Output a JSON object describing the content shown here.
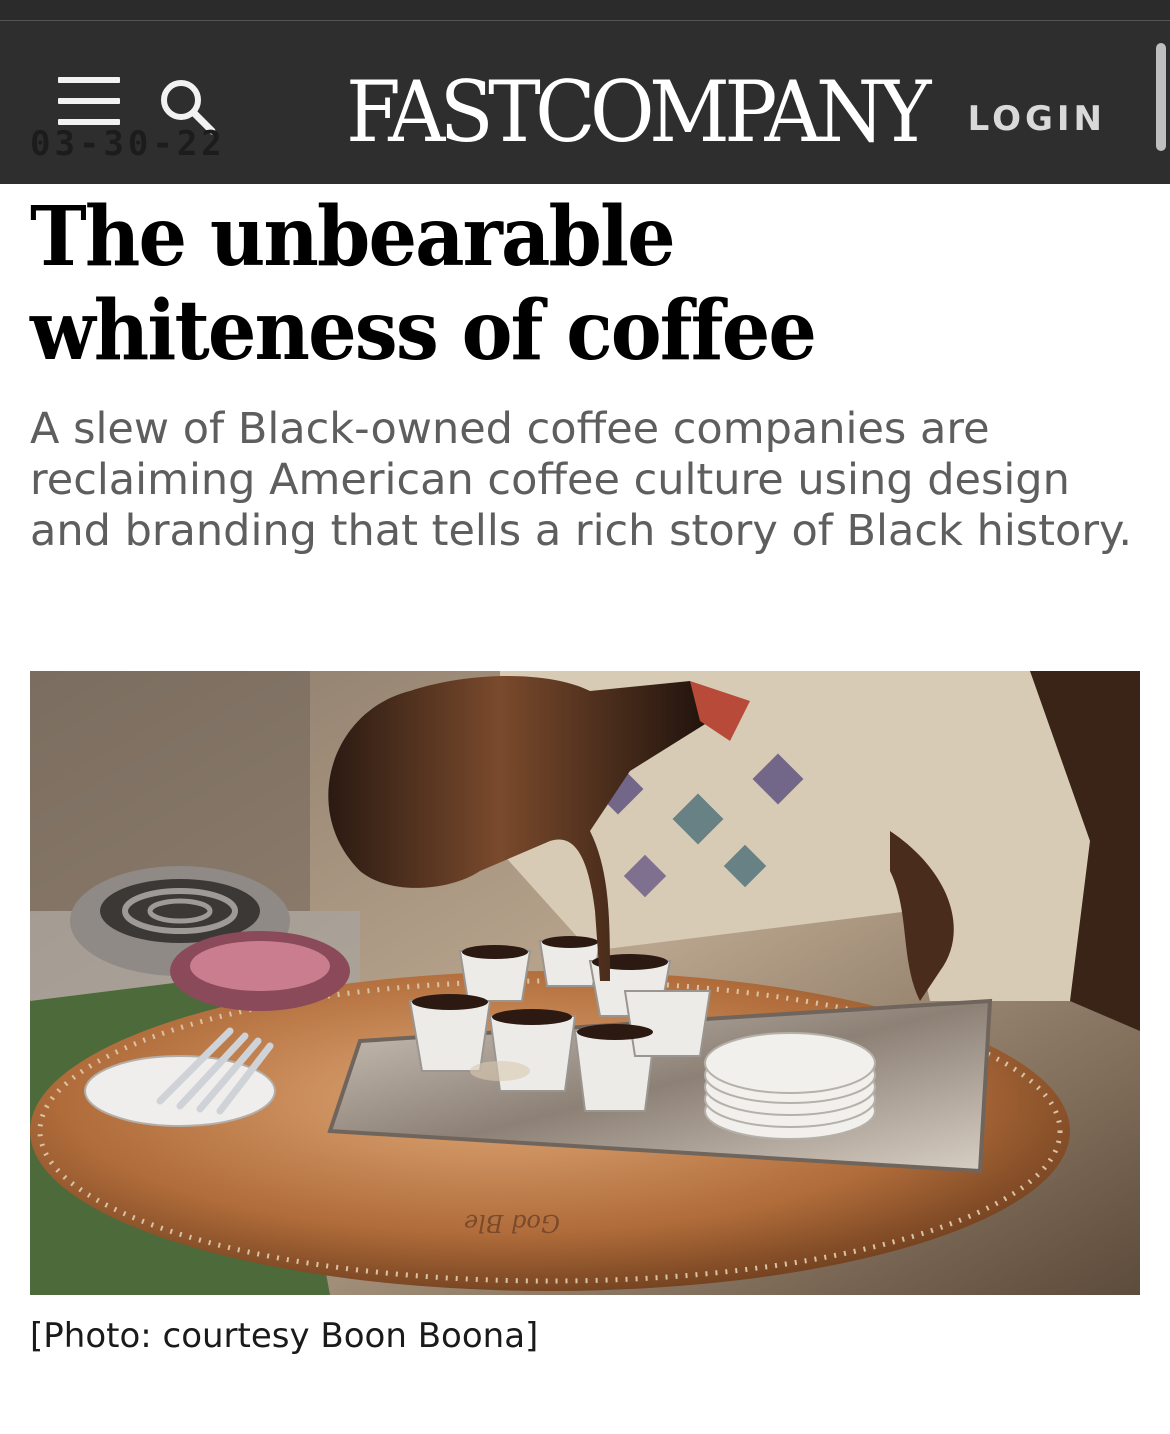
{
  "header": {
    "menu_icon": "hamburger-menu-icon",
    "search_icon": "search-icon",
    "logo_text": "FASTCOMPANY",
    "login_label": "LOGIN",
    "background_color": "#2e2e2e"
  },
  "article": {
    "date": "03-30-22",
    "headline": "The unbearable whiteness of coffee",
    "deck": "A slew of Black-owned coffee companies are reclaiming American coffee culture using design and branding that tells a rich story of Black history.",
    "image_caption": "[Photo: courtesy Boon Boona]"
  }
}
